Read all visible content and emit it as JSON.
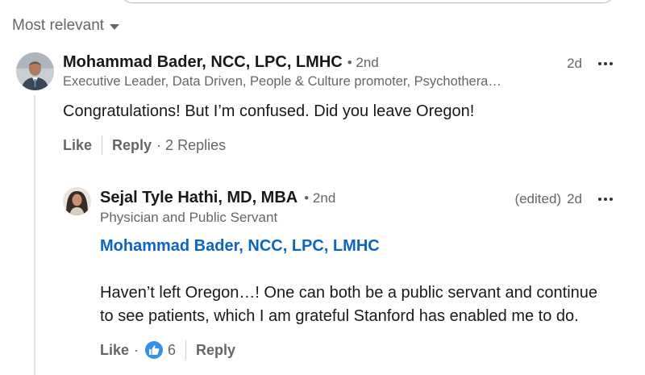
{
  "sort": {
    "label": "Most relevant"
  },
  "comment": {
    "author": "Mohammad Bader, NCC, LPC, LMHC",
    "degree": "• 2nd",
    "headline": "Executive Leader, Data Driven, People & Culture promoter, Psychothera…",
    "time": "2d",
    "text": "Congratulations! But I’m confused. Did you leave Oregon!",
    "like_label": "Like",
    "reply_label": "Reply",
    "replies_count": "· 2 Replies"
  },
  "reply": {
    "author": "Sejal Tyle Hathi, MD, MBA",
    "degree": "• 2nd",
    "headline": "Physician and Public Servant",
    "edited": "(edited)",
    "time": "2d",
    "mention": "Mohammad Bader, NCC, LPC, LMHC",
    "text_line1": "Haven’t left Oregon…! One can both be a public servant and continue",
    "text_line2": "to see patients, which I am grateful Stanford has enabled me to do.",
    "like_label": "Like",
    "like_dot": "·",
    "reaction_count": "6",
    "reply_label": "Reply"
  },
  "colors": {
    "accent": "#0a66c2",
    "reaction": "#378fe9"
  },
  "icons": {
    "sort": "caret-down-icon",
    "more": "more-dots-icon",
    "reaction": "thumbs-up-icon"
  }
}
